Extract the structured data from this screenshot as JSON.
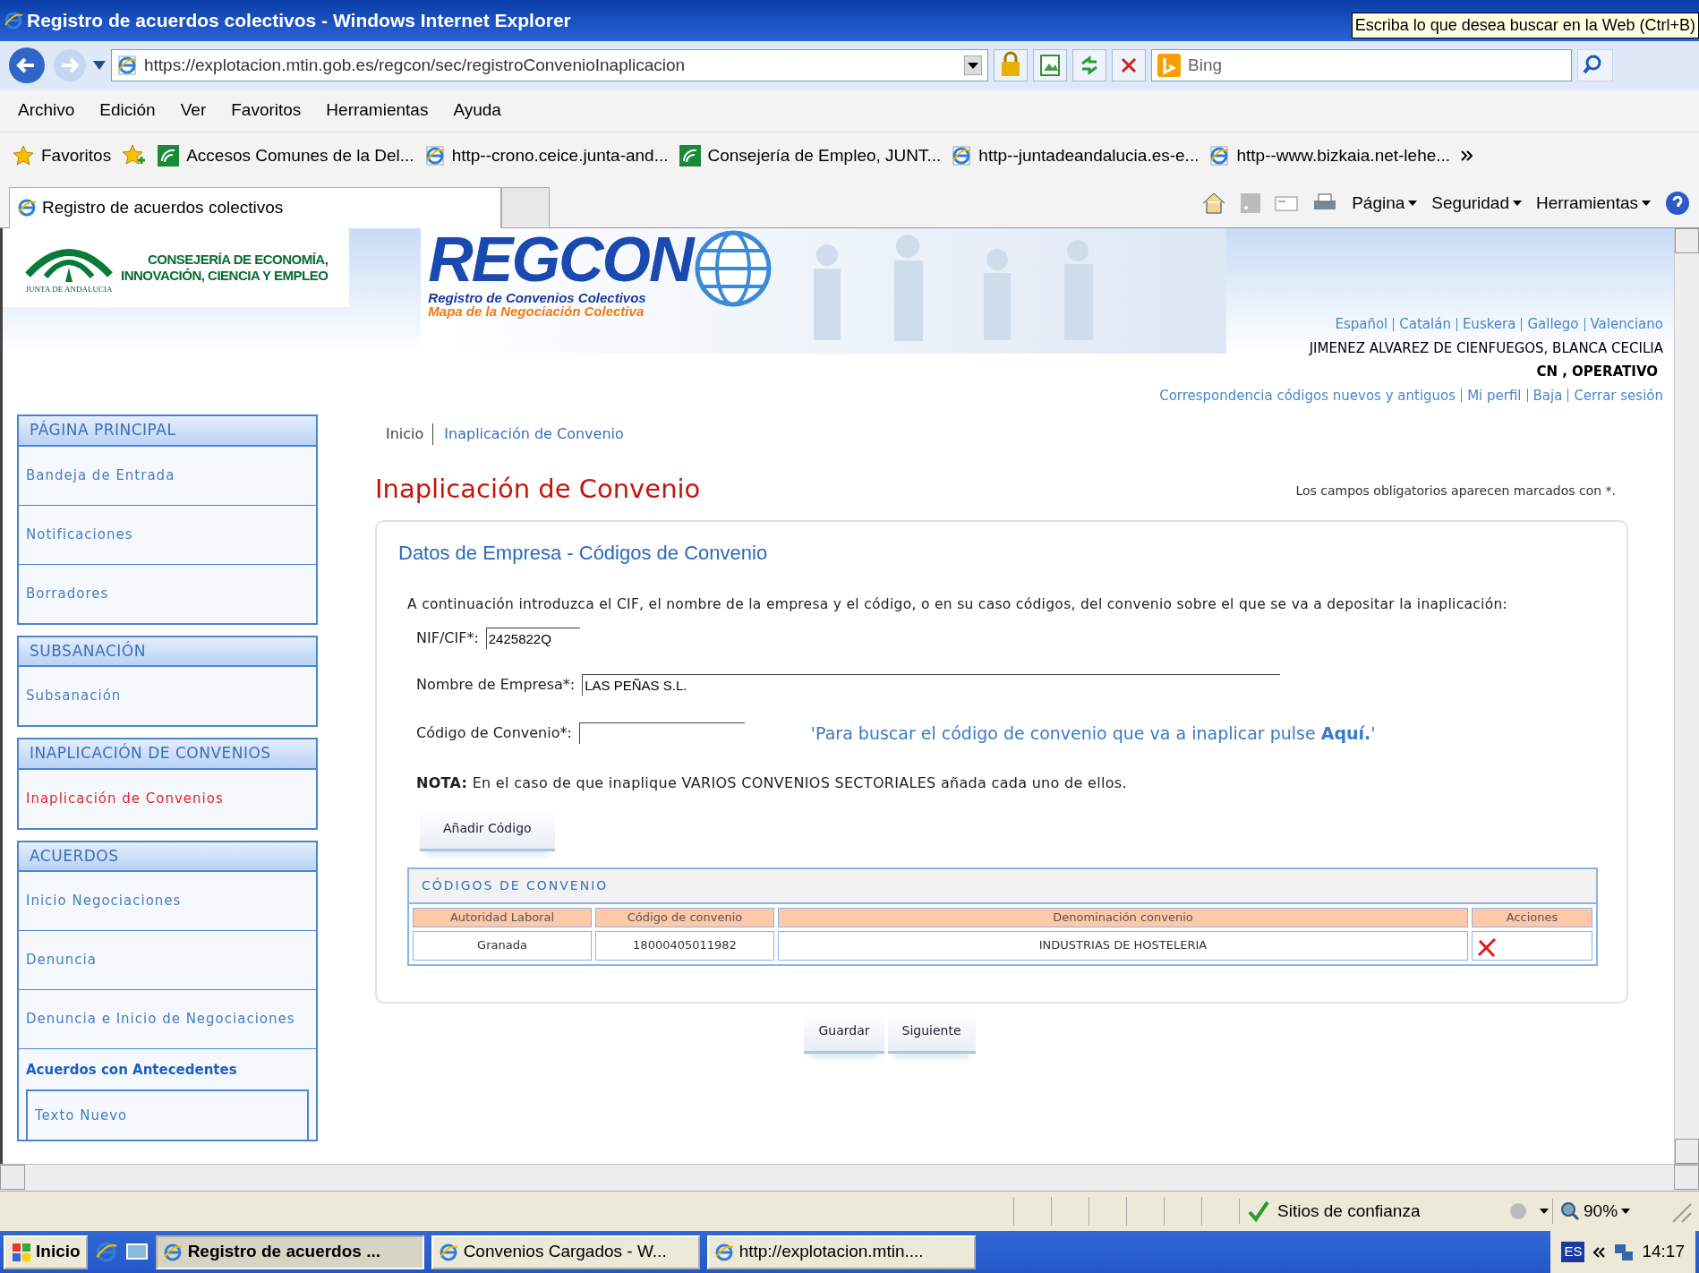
{
  "window": {
    "title": "Registro de acuerdos colectivos - Windows Internet Explorer",
    "search_tooltip": "Escriba lo que desea buscar en la Web (Ctrl+B)"
  },
  "address_bar": {
    "url": "https://explotacion.mtin.gob.es/regcon/sec/registroConvenioInaplicacion",
    "search_placeholder": "Bing"
  },
  "menu": [
    "Archivo",
    "Edición",
    "Ver",
    "Favoritos",
    "Herramientas",
    "Ayuda"
  ],
  "favorites": {
    "label": "Favoritos",
    "links": [
      {
        "kind": "site",
        "label": "Accesos Comunes de la Del..."
      },
      {
        "kind": "page",
        "label": "http--crono.ceice.junta-and..."
      },
      {
        "kind": "site",
        "label": "Consejería de Empleo, JUNT..."
      },
      {
        "kind": "page",
        "label": "http--juntadeandalucia.es-e..."
      },
      {
        "kind": "page",
        "label": "http--www.bizkaia.net-lehe..."
      }
    ]
  },
  "tab": {
    "title": "Registro de acuerdos colectivos"
  },
  "command_bar": [
    "Página",
    "Seguridad",
    "Herramientas"
  ],
  "header": {
    "org_small": "JUNTA DE ANDALUCIA",
    "org_line1": "CONSEJERÍA DE ECONOMÍA,",
    "org_line2": "INNOVACIÓN, CIENCIA Y EMPLEO",
    "app_title": "REGCON",
    "app_sub1": "Registro de Convenios Colectivos",
    "app_sub2": "Mapa de la Negociación Colectiva",
    "languages": [
      "Español",
      "Catalán",
      "Euskera",
      "Gallego",
      "Valenciano"
    ],
    "user": "JIMENEZ ALVAREZ DE CIENFUEGOS, BLANCA CECILIA",
    "role": "CN , OPERATIVO",
    "links": [
      "Correspondencia códigos nuevos y antiguos",
      "Mi perfil",
      "Baja",
      "Cerrar sesión"
    ]
  },
  "sidebar": [
    {
      "title": "PÁGINA PRINCIPAL",
      "items": [
        {
          "kind": "link",
          "label": "Bandeja de Entrada",
          "selected": false
        },
        {
          "kind": "link",
          "label": "Notificaciones",
          "selected": false
        },
        {
          "kind": "link",
          "label": "Borradores",
          "selected": false
        }
      ]
    },
    {
      "title": "SUBSANACIÓN",
      "items": [
        {
          "kind": "link",
          "label": "Subsanación",
          "selected": false
        }
      ]
    },
    {
      "title": "INAPLICACIÓN DE CONVENIOS",
      "items": [
        {
          "kind": "link",
          "label": "Inaplicación de Convenios",
          "selected": true
        }
      ]
    },
    {
      "title": "ACUERDOS",
      "items": [
        {
          "kind": "link",
          "label": "Inicio Negociaciones",
          "selected": false
        },
        {
          "kind": "link",
          "label": "Denuncia",
          "selected": false
        },
        {
          "kind": "link",
          "label": "Denuncia e Inicio de Negociaciones",
          "selected": false
        },
        {
          "kind": "group",
          "label": "Acuerdos con Antecedentes",
          "children": [
            {
              "label": "Texto Nuevo",
              "selected": false
            }
          ]
        }
      ]
    }
  ],
  "breadcrumb": [
    "Inicio",
    "Inaplicación de Convenio"
  ],
  "page_title": "Inaplicación de Convenio",
  "required_note": "Los campos obligatorios aparecen marcados con *.",
  "panel": {
    "title": "Datos de Empresa - Códigos de Convenio",
    "intro": "A continuación introduzca el CIF, el nombre de la empresa y el código, o en su caso códigos, del convenio sobre el que se va a depositar la inaplicación:",
    "fields": [
      {
        "kind": "short",
        "label": "NIF/CIF*:",
        "value": "2425822Q"
      },
      {
        "kind": "long",
        "label": "Nombre de Empresa*:",
        "value": "LAS PEÑAS S.L."
      },
      {
        "kind": "code",
        "label": "Código de Convenio*:"
      }
    ],
    "search_hint": "'Para buscar el código de convenio que va a inaplicar pulse **Aquí.**'",
    "note": "**NOTA:** En el caso de que inaplique VARIOS CONVENIOS SECTORIALES añada cada uno de ellos.",
    "add_button": "Añadir Código",
    "table": {
      "title": "CÓDIGOS DE CONVENIO",
      "columns": [
        "Autoridad Laboral",
        "Código de convenio",
        "Denominación convenio",
        "Acciones"
      ],
      "rows": [
        [
          "Granada",
          "18000405011982",
          "INDUSTRIAS DE HOSTELERIA"
        ]
      ]
    }
  },
  "buttons": [
    "Guardar",
    "Siguiente"
  ],
  "status_bar": {
    "zone": "Sitios de confianza",
    "zoom": "90%"
  },
  "taskbar": {
    "start": "Inicio",
    "tasks": [
      {
        "label": "Registro de acuerdos ...",
        "selected": true
      },
      {
        "label": "Convenios Cargados - W...",
        "selected": false
      },
      {
        "label": "http://explotacion.mtin....",
        "selected": false
      }
    ],
    "lang": "ES",
    "clock": "14:17"
  }
}
